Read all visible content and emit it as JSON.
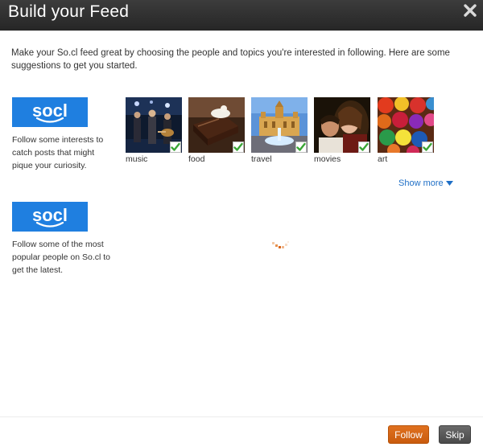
{
  "dialog": {
    "title": "Build your Feed",
    "close_icon": "close-icon"
  },
  "intro": {
    "text": "Make your So.cl feed great by choosing the people and topics you're interested in following. Here are some suggestions to get you started."
  },
  "interests_section": {
    "logo_text": "socl",
    "description": "Follow some interests to catch posts that might pique your curiosity.",
    "topics": [
      {
        "label": "music",
        "selected": true
      },
      {
        "label": "food",
        "selected": true
      },
      {
        "label": "travel",
        "selected": true
      },
      {
        "label": "movies",
        "selected": true
      },
      {
        "label": "art",
        "selected": true
      }
    ],
    "show_more_label": "Show more"
  },
  "people_section": {
    "logo_text": "socl",
    "description": "Follow some of the most popular people on So.cl to get the latest.",
    "loading": true
  },
  "footer": {
    "follow_label": "Follow",
    "skip_label": "Skip"
  },
  "colors": {
    "titlebar": "#2e2e2e",
    "brand_blue": "#1f7fe0",
    "follow_orange": "#d8661a",
    "skip_gray": "#555555",
    "check_green": "#3aa636"
  }
}
